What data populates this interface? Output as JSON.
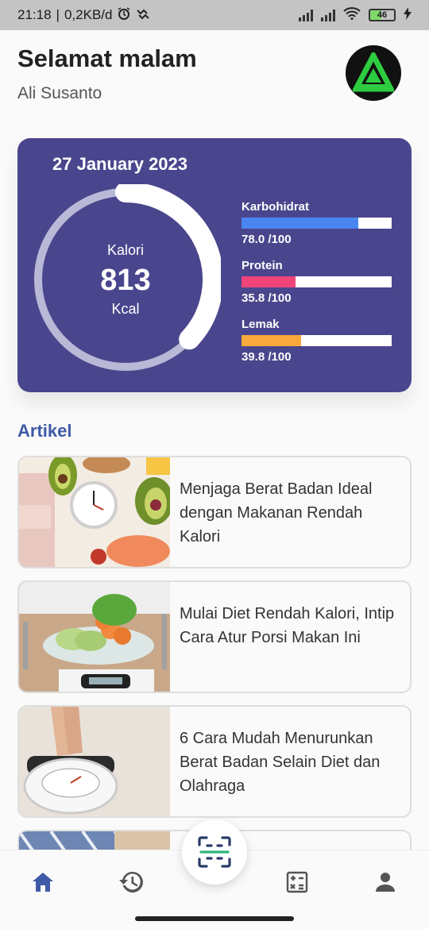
{
  "status_bar": {
    "time": "21:18",
    "network_speed": "0,2KB/d",
    "battery": "46"
  },
  "header": {
    "greeting": "Selamat malam",
    "user_name": "Ali Susanto"
  },
  "summary": {
    "date": "27 January 2023",
    "calorie_label": "Kalori",
    "calorie_value": "813",
    "calorie_unit": "Kcal",
    "calorie_ring_progress": 0.37,
    "macros": [
      {
        "name": "Karbohidrat",
        "value_text": "78.0 /100",
        "fraction": 0.78,
        "color": "#4a86f0"
      },
      {
        "name": "Protein",
        "value_text": "35.8 /100",
        "fraction": 0.358,
        "color": "#f0457a"
      },
      {
        "name": "Lemak",
        "value_text": "39.8 /100",
        "fraction": 0.398,
        "color": "#f9a93c"
      }
    ]
  },
  "articles_section": {
    "title": "Artikel",
    "items": [
      {
        "title": "Menjaga Berat Badan Ideal dengan Makanan Rendah Kalori"
      },
      {
        "title": "Mulai Diet Rendah Kalori, Intip Cara Atur Porsi Makan Ini"
      },
      {
        "title": "6 Cara Mudah Menurunkan Berat Badan Selain Diet dan Olahraga"
      }
    ]
  },
  "bottom_nav": {
    "items": [
      {
        "icon": "home-icon",
        "active": true
      },
      {
        "icon": "history-icon",
        "active": false
      },
      {
        "icon": "scan-icon",
        "active": false
      },
      {
        "icon": "calculator-icon",
        "active": false
      },
      {
        "icon": "profile-icon",
        "active": false
      }
    ],
    "active_color": "#3f5aa6",
    "inactive_color": "#555555"
  }
}
